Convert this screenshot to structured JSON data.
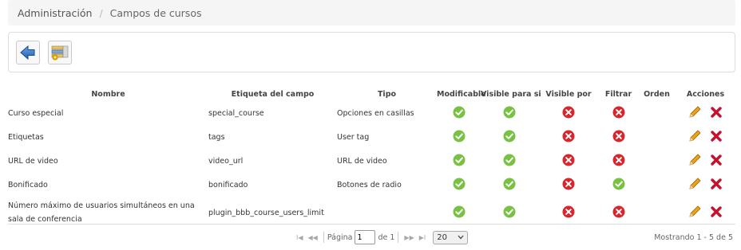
{
  "breadcrumb": {
    "root": "Administración",
    "separator": "/",
    "current": "Campos de cursos"
  },
  "toolbar": {
    "back_icon": "back-arrow-icon",
    "add_icon": "add-field-icon"
  },
  "table": {
    "headers": {
      "nombre": "Nombre",
      "etiqueta": "Etiqueta del campo",
      "tipo": "Tipo",
      "modificable": "Modificable",
      "visible_para_si": "Visible para si",
      "visible_por": "Visible por",
      "filtrar": "Filtrar",
      "orden": "Orden",
      "acciones": "Acciones"
    },
    "rows": [
      {
        "nombre": "Curso especial",
        "etiqueta": "special_course",
        "tipo": "Opciones en casillas",
        "modificable": true,
        "visible_para_si": true,
        "visible_por": false,
        "filtrar": false,
        "orden": ""
      },
      {
        "nombre": "Etiquetas",
        "etiqueta": "tags",
        "tipo": "User tag",
        "modificable": true,
        "visible_para_si": true,
        "visible_por": false,
        "filtrar": false,
        "orden": ""
      },
      {
        "nombre": "URL de video",
        "etiqueta": "video_url",
        "tipo": "URL de video",
        "modificable": true,
        "visible_para_si": true,
        "visible_por": false,
        "filtrar": false,
        "orden": ""
      },
      {
        "nombre": "Bonificado",
        "etiqueta": "bonificado",
        "tipo": "Botones de radio",
        "modificable": true,
        "visible_para_si": true,
        "visible_por": false,
        "filtrar": true,
        "orden": ""
      },
      {
        "nombre": "Número máximo de usuarios simultáneos en una sala de conferencia",
        "etiqueta": "plugin_bbb_course_users_limit",
        "tipo": "",
        "modificable": true,
        "visible_para_si": true,
        "visible_por": false,
        "filtrar": false,
        "orden": ""
      }
    ]
  },
  "pager": {
    "page_label": "Página",
    "page_value": "1",
    "of_label": "de 1",
    "rows_per_page": "20",
    "showing": "Mostrando 1 - 5 de 5"
  },
  "colors": {
    "ok": "#79c143",
    "error": "#d9262d",
    "edit": "#e8a21b",
    "delete": "#c8102e"
  }
}
